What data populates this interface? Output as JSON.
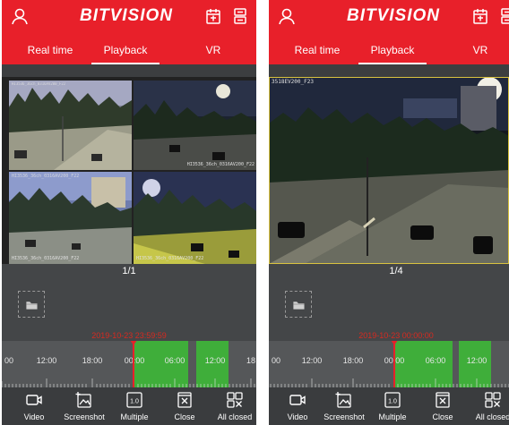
{
  "header": {
    "logo": "BITVISION",
    "icons": {
      "user": "user-icon",
      "calendar": "calendar-icon",
      "device": "dvr-icon"
    }
  },
  "tabs": [
    "Real time",
    "Playback",
    "VR"
  ],
  "active_tab": "Playback",
  "screens": [
    {
      "id": "left",
      "layout": "quad",
      "channel_labels": [
        "HI3536_36ch_0316AV200_F22",
        "HI3536_36ch_0316AV200_F22",
        "HI3536_36ch_0316AV200_F22",
        "HI3536_36ch_0316AV200_F22"
      ],
      "page_indicator": "1/1",
      "timestamp": "2019-10-23 23:59:59",
      "timeline_labels": [
        "00",
        "12:00",
        "18:00",
        "00:00",
        "06:00",
        "12:00",
        "18"
      ]
    },
    {
      "id": "right",
      "layout": "single",
      "channel_labels": [
        "3518EV200_F23"
      ],
      "page_indicator": "1/4",
      "timestamp": "2019-10-23 00:00:00",
      "timeline_labels": [
        "00",
        "12:00",
        "18:00",
        "00:00",
        "06:00",
        "12:00"
      ]
    }
  ],
  "toolbar": [
    {
      "label": "Video",
      "icon": "video-camera-icon"
    },
    {
      "label": "Screenshot",
      "icon": "screenshot-icon"
    },
    {
      "label": "Multiple",
      "icon": "speed-icon",
      "value": "1.0"
    },
    {
      "label": "Close",
      "icon": "close-icon"
    },
    {
      "label": "All closed",
      "icon": "close-all-icon"
    }
  ],
  "colors": {
    "brand_red": "#e8202a",
    "recording_green": "#3fae3a",
    "timestamp_red": "#d62a20"
  }
}
